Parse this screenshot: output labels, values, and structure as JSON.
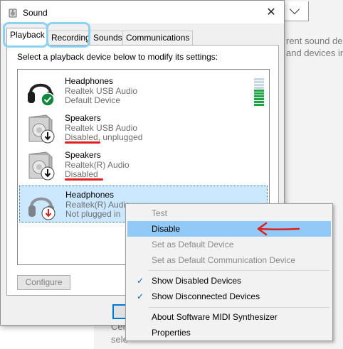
{
  "background": {
    "line1": "rent sound de",
    "line2": "and devices in",
    "line3": "Cer",
    "line4": "sele"
  },
  "dialog": {
    "title": "Sound",
    "close_glyph": "✕",
    "tabs": [
      {
        "label": "Playback"
      },
      {
        "label": "Recording"
      },
      {
        "label": "Sounds"
      },
      {
        "label": "Communications"
      }
    ],
    "instruction": "Select a playback device below to modify its settings:",
    "devices": [
      {
        "name": "Headphones",
        "driver": "Realtek USB Audio",
        "status": "Default Device",
        "badge": "check",
        "icon": "headphones-icon",
        "level": 0.6
      },
      {
        "name": "Speakers",
        "driver": "Realtek USB Audio",
        "status": "Disabled, unplugged",
        "badge": "down-arrow",
        "icon": "speaker-icon"
      },
      {
        "name": "Speakers",
        "driver": "Realtek(R) Audio",
        "status": "Disabled",
        "badge": "down-arrow",
        "icon": "speaker-icon"
      },
      {
        "name": "Headphones",
        "driver": "Realtek(R) Audio",
        "status": "Not plugged in",
        "badge": "red-down-arrow",
        "icon": "headphones-icon"
      }
    ],
    "configure_label": "Configure",
    "colors": {
      "accent": "#0078d7",
      "selection": "#cce8ff",
      "menu_highlight": "#91c9f7",
      "annotation_red": "#e02020",
      "annotation_blue": "#8fd1f0",
      "check_green": "#10893e"
    }
  },
  "context_menu": {
    "items": [
      {
        "label": "Test",
        "enabled": false
      },
      {
        "label": "Disable",
        "enabled": true,
        "highlighted": true
      },
      {
        "label": "Set as Default Device",
        "enabled": false
      },
      {
        "label": "Set as Default Communication Device",
        "enabled": false
      },
      {
        "label": "Show Disabled Devices",
        "enabled": true,
        "checked": true
      },
      {
        "label": "Show Disconnected Devices",
        "enabled": true,
        "checked": true
      },
      {
        "label": "About Software MIDI Synthesizer",
        "enabled": true
      },
      {
        "label": "Properties",
        "enabled": true
      }
    ],
    "check_glyph": "✓"
  }
}
